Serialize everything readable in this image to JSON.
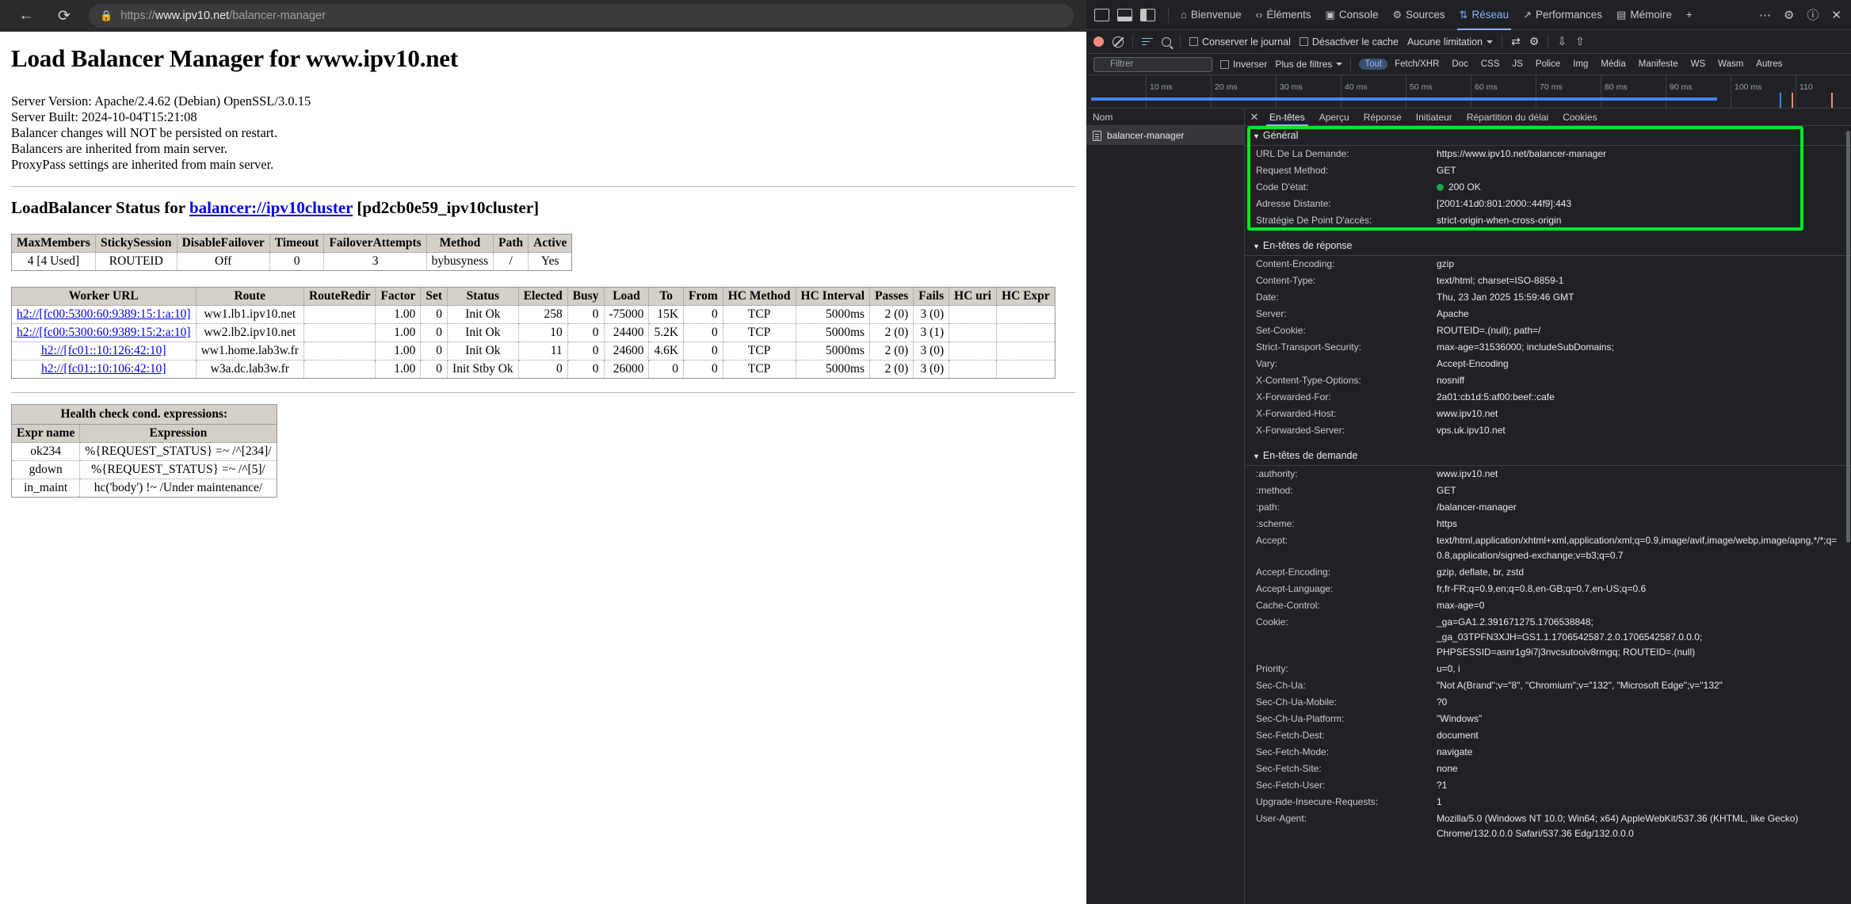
{
  "browser": {
    "back_icon": "back-arrow-icon",
    "reload_icon": "reload-icon",
    "lock_icon": "lock-icon",
    "url_scheme": "https://",
    "url_host": "www.ipv10.net",
    "url_path": "/balancer-manager",
    "url_full": "https://www.ipv10.net/balancer-manager",
    "right_icons": [
      "reading-aloud-icon",
      "favorite-icon",
      "collections-icon",
      "more-icon",
      "settings-icon",
      "account-icon"
    ]
  },
  "page": {
    "title": "Load Balancer Manager for www.ipv10.net",
    "server_lines": [
      "Server Version: Apache/2.4.62 (Debian) OpenSSL/3.0.15",
      "Server Built: 2024-10-04T15:21:08",
      "Balancer changes will NOT be persisted on restart.",
      "Balancers are inherited from main server.",
      "ProxyPass settings are inherited from main server."
    ],
    "lb_status_prefix": "LoadBalancer Status for ",
    "lb_status_link": "balancer://ipv10cluster",
    "lb_status_suffix": " [pd2cb0e59_ipv10cluster]",
    "balancer_table": {
      "headers": [
        "MaxMembers",
        "StickySession",
        "DisableFailover",
        "Timeout",
        "FailoverAttempts",
        "Method",
        "Path",
        "Active"
      ],
      "rows": [
        [
          "4 [4 Used]",
          "ROUTEID",
          "Off",
          "0",
          "3",
          "bybusyness",
          "/",
          "Yes"
        ]
      ]
    },
    "worker_table": {
      "headers": [
        "Worker URL",
        "Route",
        "RouteRedir",
        "Factor",
        "Set",
        "Status",
        "Elected",
        "Busy",
        "Load",
        "To",
        "From",
        "HC Method",
        "HC Interval",
        "Passes",
        "Fails",
        "HC uri",
        "HC Expr"
      ],
      "rows": [
        {
          "url": "h2://[fc00:5300:60:9389:15:1:a:10]",
          "cells": [
            "ww1.lb1.ipv10.net",
            "",
            "1.00",
            "0",
            "Init Ok",
            "258",
            "0",
            "-75000",
            "15K",
            "0",
            "TCP",
            "5000ms",
            "2 (0)",
            "3 (0)",
            "",
            ""
          ]
        },
        {
          "url": "h2://[fc00:5300:60:9389:15:2:a:10]",
          "cells": [
            "ww2.lb2.ipv10.net",
            "",
            "1.00",
            "0",
            "Init Ok",
            "10",
            "0",
            "24400",
            "5.2K",
            "0",
            "TCP",
            "5000ms",
            "2 (0)",
            "3 (1)",
            "",
            ""
          ]
        },
        {
          "url": "h2://[fc01::10:126:42:10]",
          "cells": [
            "ww1.home.lab3w.fr",
            "",
            "1.00",
            "0",
            "Init Ok",
            "11",
            "0",
            "24600",
            "4.6K",
            "0",
            "TCP",
            "5000ms",
            "2 (0)",
            "3 (0)",
            "",
            ""
          ]
        },
        {
          "url": "h2://[fc01::10:106:42:10]",
          "cells": [
            "w3a.dc.lab3w.fr",
            "",
            "1.00",
            "0",
            "Init Stby Ok",
            "0",
            "0",
            "26000",
            "0",
            "0",
            "TCP",
            "5000ms",
            "2 (0)",
            "3 (0)",
            "",
            ""
          ]
        }
      ]
    },
    "hc_table": {
      "caption": "Health check cond. expressions:",
      "headers": [
        "Expr name",
        "Expression"
      ],
      "rows": [
        [
          "ok234",
          "%{REQUEST_STATUS} =~ /^[234]/"
        ],
        [
          "gdown",
          "%{REQUEST_STATUS} =~ /^[5]/"
        ],
        [
          "in_maint",
          "hc('body') !~ /Under maintenance/"
        ]
      ]
    }
  },
  "devtools": {
    "tabs": [
      {
        "label": "Bienvenue",
        "icon": "home-icon",
        "active": false
      },
      {
        "label": "Éléments",
        "icon": "code-icon",
        "active": false
      },
      {
        "label": "Console",
        "icon": "console-icon",
        "active": false
      },
      {
        "label": "Sources",
        "icon": "sources-icon",
        "active": false
      },
      {
        "label": "Réseau",
        "icon": "network-icon",
        "active": true
      },
      {
        "label": "Performances",
        "icon": "performance-icon",
        "active": false
      },
      {
        "label": "Mémoire",
        "icon": "memory-icon",
        "active": false
      }
    ],
    "tab_add_label": "+",
    "right_icons": [
      "more-tabs-icon",
      "settings-gear-icon",
      "help-icon",
      "close-icon"
    ],
    "toolbar": {
      "record_icon": "record-stop-icon",
      "clear_icon": "clear-network-icon",
      "filter_icon": "filter-icon",
      "search_icon": "search-icon",
      "preserve_log": "Conserver le journal",
      "disable_cache": "Désactiver le cache",
      "throttling": "Aucune limitation",
      "import_icon": "import-har-icon",
      "export_icon": "export-har-icon",
      "settings_icon": "network-settings-icon"
    },
    "filterbar": {
      "filter_placeholder": "Filtrer",
      "invert": "Inverser",
      "more_filters": "Plus de filtres",
      "types": [
        "Tout",
        "Fetch/XHR",
        "Doc",
        "CSS",
        "JS",
        "Police",
        "Img",
        "Média",
        "Manifeste",
        "WS",
        "Wasm",
        "Autres"
      ],
      "active_type": "Tout"
    },
    "overview": {
      "ticks": [
        "10 ms",
        "20 ms",
        "30 ms",
        "40 ms",
        "50 ms",
        "60 ms",
        "70 ms",
        "80 ms",
        "90 ms",
        "100 ms",
        "110"
      ]
    },
    "request_list": {
      "column": "Nom",
      "items": [
        {
          "name": "balancer-manager",
          "icon": "document-icon",
          "selected": true
        }
      ]
    },
    "detail_tabs": [
      {
        "label": "En-têtes",
        "active": true
      },
      {
        "label": "Aperçu",
        "active": false
      },
      {
        "label": "Réponse",
        "active": false
      },
      {
        "label": "Initiateur",
        "active": false
      },
      {
        "label": "Répartition du délai",
        "active": false
      },
      {
        "label": "Cookies",
        "active": false
      }
    ],
    "sections": [
      {
        "title": "Général",
        "highlighted": true,
        "highlight_color": "#00e829",
        "rows": [
          {
            "key": "URL De La Demande:",
            "value": "https://www.ipv10.net/balancer-manager"
          },
          {
            "key": "Request Method:",
            "value": "GET"
          },
          {
            "key": "Code D'état:",
            "value": "200 OK",
            "status_dot": "#1ea446"
          },
          {
            "key": "Adresse Distante:",
            "value": "[2001:41d0:801:2000::44f9]:443"
          },
          {
            "key": "Stratégie De Point D'accès:",
            "value": "strict-origin-when-cross-origin"
          }
        ]
      },
      {
        "title": "En-têtes de réponse",
        "highlighted": false,
        "rows": [
          {
            "key": "Content-Encoding:",
            "value": "gzip"
          },
          {
            "key": "Content-Type:",
            "value": "text/html; charset=ISO-8859-1"
          },
          {
            "key": "Date:",
            "value": "Thu, 23 Jan 2025 15:59:46 GMT"
          },
          {
            "key": "Server:",
            "value": "Apache"
          },
          {
            "key": "Set-Cookie:",
            "value": "ROUTEID=.(null); path=/"
          },
          {
            "key": "Strict-Transport-Security:",
            "value": "max-age=31536000; includeSubDomains;"
          },
          {
            "key": "Vary:",
            "value": "Accept-Encoding"
          },
          {
            "key": "X-Content-Type-Options:",
            "value": "nosniff"
          },
          {
            "key": "X-Forwarded-For:",
            "value": "2a01:cb1d:5:af00:beef::cafe"
          },
          {
            "key": "X-Forwarded-Host:",
            "value": "www.ipv10.net"
          },
          {
            "key": "X-Forwarded-Server:",
            "value": "vps.uk.ipv10.net"
          }
        ]
      },
      {
        "title": "En-têtes de demande",
        "highlighted": false,
        "rows": [
          {
            "key": ":authority:",
            "value": "www.ipv10.net"
          },
          {
            "key": ":method:",
            "value": "GET"
          },
          {
            "key": ":path:",
            "value": "/balancer-manager"
          },
          {
            "key": ":scheme:",
            "value": "https"
          },
          {
            "key": "Accept:",
            "value": "text/html,application/xhtml+xml,application/xml;q=0.9,image/avif,image/webp,image/apng,*/*;q=0.8,application/signed-exchange;v=b3;q=0.7"
          },
          {
            "key": "Accept-Encoding:",
            "value": "gzip, deflate, br, zstd"
          },
          {
            "key": "Accept-Language:",
            "value": "fr,fr-FR;q=0.9,en;q=0.8,en-GB;q=0.7,en-US;q=0.6"
          },
          {
            "key": "Cache-Control:",
            "value": "max-age=0"
          },
          {
            "key": "Cookie:",
            "value": "_ga=GA1.2.391671275.1706538848;\n_ga_03TPFN3XJH=GS1.1.1706542587.2.0.1706542587.0.0.0;\nPHPSESSID=asnr1g9i7j3nvcsutooiv8rmgq; ROUTEID=.(null)"
          },
          {
            "key": "Priority:",
            "value": "u=0, i"
          },
          {
            "key": "Sec-Ch-Ua:",
            "value": "\"Not A(Brand\";v=\"8\", \"Chromium\";v=\"132\", \"Microsoft Edge\";v=\"132\""
          },
          {
            "key": "Sec-Ch-Ua-Mobile:",
            "value": "?0"
          },
          {
            "key": "Sec-Ch-Ua-Platform:",
            "value": "\"Windows\""
          },
          {
            "key": "Sec-Fetch-Dest:",
            "value": "document"
          },
          {
            "key": "Sec-Fetch-Mode:",
            "value": "navigate"
          },
          {
            "key": "Sec-Fetch-Site:",
            "value": "none"
          },
          {
            "key": "Sec-Fetch-User:",
            "value": "?1"
          },
          {
            "key": "Upgrade-Insecure-Requests:",
            "value": "1"
          },
          {
            "key": "User-Agent:",
            "value": "Mozilla/5.0 (Windows NT 10.0; Win64; x64) AppleWebKit/537.36 (KHTML, like Gecko)\nChrome/132.0.0.0 Safari/537.36 Edg/132.0.0.0"
          }
        ]
      }
    ]
  }
}
